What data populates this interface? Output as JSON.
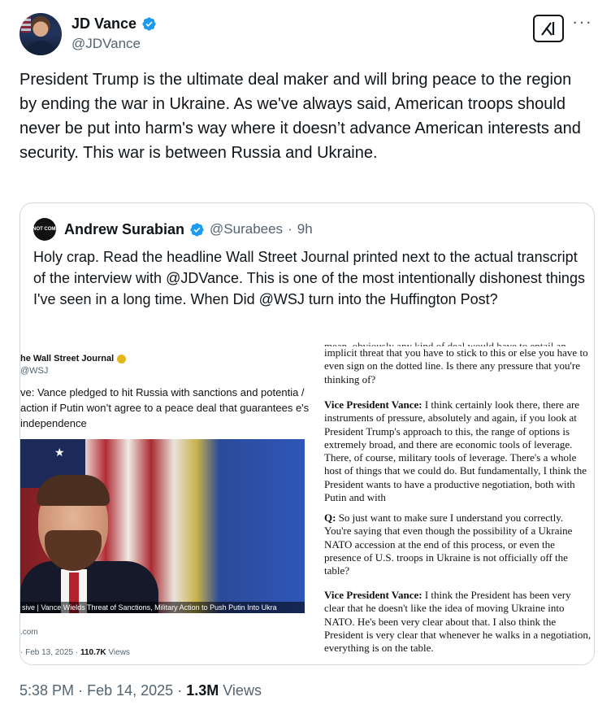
{
  "author": {
    "display_name": "JD Vance",
    "handle": "@JDVance"
  },
  "tweet": {
    "text": "President Trump is the ultimate deal maker and will bring peace to the region by ending the war in Ukraine. As we've always said, American troops should never be put into harm's way where it doesn’t advance American interests and security. This war is between Russia and Ukraine.",
    "time": "5:38 PM",
    "date": "Feb 14, 2025",
    "views_count": "1.3M",
    "views_label": "Views",
    "separator": "·"
  },
  "quoted": {
    "avatar_text": "DO NOT COMPLY.",
    "display_name": "Andrew Surabian",
    "handle": "@Surabees",
    "age": "9h",
    "text": "Holy crap. Read the headline Wall Street Journal printed next to the actual transcript of the interview with @JDVance. This is one of the most intentionally dishonest things I've seen in a long time. When Did @WSJ turn into the Huffington Post?"
  },
  "wsj_screenshot": {
    "name": "he Wall Street Journal",
    "handle": "@WSJ",
    "headline": "ve: Vance pledged to hit Russia with sanctions and potentia / action if Putin won’t agree to a peace deal that guarantees e's independence",
    "caption": "sive | Vance Wields Threat of Sanctions, Military Action to Push Putin Into Ukra",
    "link": ".com",
    "date": "· Feb 13, 2025 ·",
    "views_count": "110.7K",
    "views_label": "Views"
  },
  "transcript": {
    "cut_line": "mean, obviously any kind of deal would have to entail an",
    "p1": "implicit threat that you have to stick to this or else you have to even sign on the dotted line. Is there any pressure that you're thinking of?",
    "speaker1": "Vice President Vance:",
    "p2": " I think certainly look there, there are instruments of pressure, absolutely and again, if you look at President Trump's approach to this, the range of options is extremely broad, and there are economic tools of leverage. There, of course, military tools of leverage. There's a whole host of things that we could do. But fundamentally, I think the President wants to have a productive negotiation, both with Putin and with",
    "speaker2": "Q:",
    "p3": " So just want to make sure I understand you correctly. You're saying that even though the possibility of a Ukraine NATO accession at the end of this process, or even the presence of U.S. troops in Ukraine is not officially off the table?",
    "speaker3": "Vice President Vance:",
    "p4": " I think the President has been very clear that he doesn't like the idea of moving Ukraine into NATO. He's been very clear about that. I also think the President is very clear that whenever he walks in a negotiation, everything is on the table."
  },
  "icons": {
    "verified": "verified-badge-icon",
    "grok": "grok-icon",
    "more": "more-icon"
  },
  "colors": {
    "verified_blue": "#1d9bf0",
    "secondary_text": "#536471",
    "border": "#cfd9de"
  }
}
